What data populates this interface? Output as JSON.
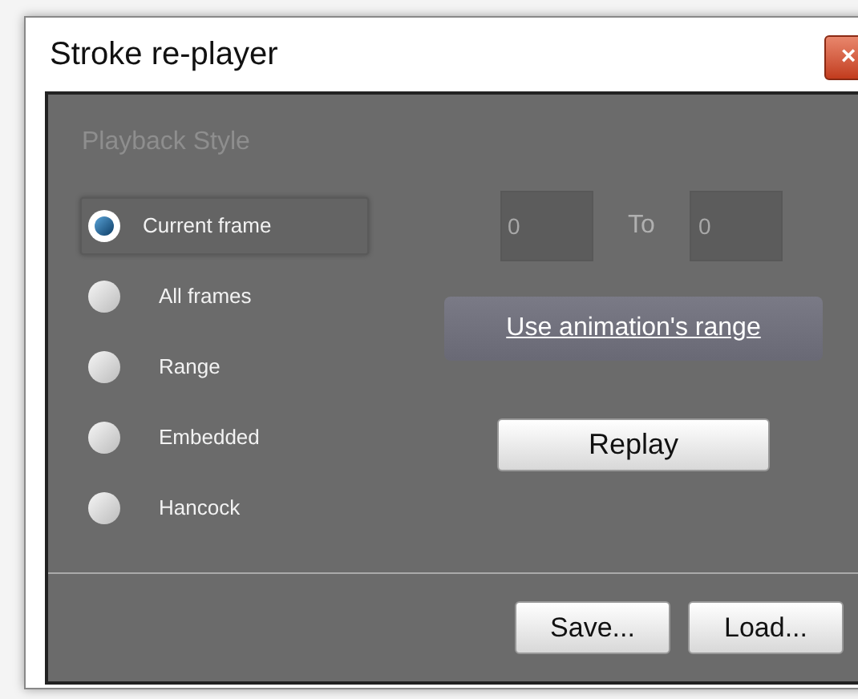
{
  "window": {
    "title": "Stroke re-player",
    "close": "×"
  },
  "group": {
    "title": "Playback Style"
  },
  "styles": [
    {
      "label": "Current frame",
      "selected": true
    },
    {
      "label": "All frames",
      "selected": false
    },
    {
      "label": "Range",
      "selected": false
    },
    {
      "label": "Embedded",
      "selected": false
    },
    {
      "label": "Hancock",
      "selected": false
    }
  ],
  "range": {
    "from": {
      "value": "0",
      "disabled": true
    },
    "to_label": "To",
    "to": {
      "value": "0",
      "disabled": true
    }
  },
  "link": "Use animation's range",
  "replay": "Replay",
  "footer": [
    "Save...",
    "Load..."
  ]
}
